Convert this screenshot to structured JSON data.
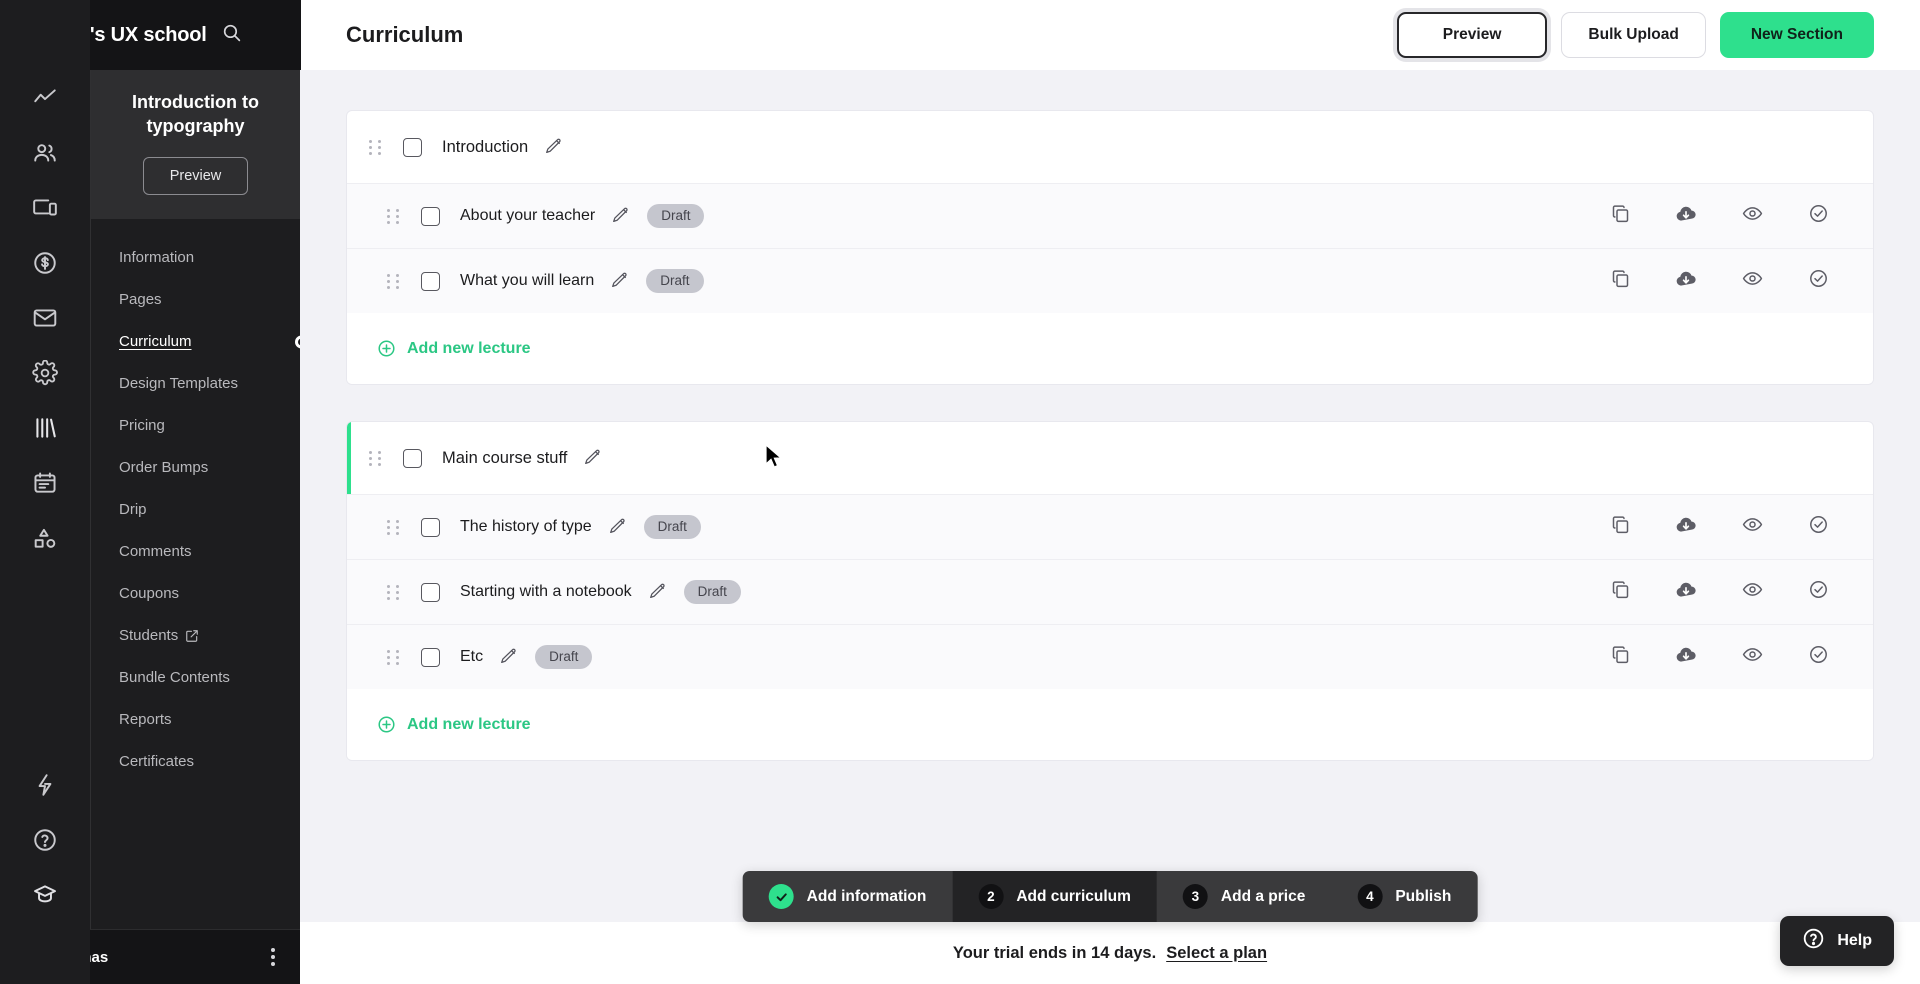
{
  "brand": {
    "title": "UI Feed's UX school",
    "search_icon": "search-icon"
  },
  "rail": {
    "icons": [
      {
        "name": "analytics-icon"
      },
      {
        "name": "audience-icon"
      },
      {
        "name": "devices-icon"
      },
      {
        "name": "dollar-circle-icon"
      },
      {
        "name": "mail-icon"
      },
      {
        "name": "settings-gear-icon"
      },
      {
        "name": "library-books-icon"
      },
      {
        "name": "calendar-icon"
      },
      {
        "name": "shapes-icon"
      }
    ],
    "bottom_icons": [
      {
        "name": "lightning-icon"
      },
      {
        "name": "help-circle-icon"
      },
      {
        "name": "graduation-cap-icon"
      }
    ]
  },
  "course": {
    "title": "Introduction to typography",
    "preview_label": "Preview"
  },
  "subnav": {
    "items": [
      {
        "label": "Information",
        "active": false,
        "external": false,
        "spinner": false
      },
      {
        "label": "Pages",
        "active": false,
        "external": false,
        "spinner": false
      },
      {
        "label": "Curriculum",
        "active": true,
        "external": false,
        "spinner": true
      },
      {
        "label": "Design Templates",
        "active": false,
        "external": false,
        "spinner": false
      },
      {
        "label": "Pricing",
        "active": false,
        "external": false,
        "spinner": false
      },
      {
        "label": "Order Bumps",
        "active": false,
        "external": false,
        "spinner": false
      },
      {
        "label": "Drip",
        "active": false,
        "external": false,
        "spinner": false
      },
      {
        "label": "Comments",
        "active": false,
        "external": false,
        "spinner": false
      },
      {
        "label": "Coupons",
        "active": false,
        "external": false,
        "spinner": false
      },
      {
        "label": "Students",
        "active": false,
        "external": true,
        "spinner": false
      },
      {
        "label": "Bundle Contents",
        "active": false,
        "external": false,
        "spinner": false
      },
      {
        "label": "Reports",
        "active": false,
        "external": false,
        "spinner": false
      },
      {
        "label": "Certificates",
        "active": false,
        "external": false,
        "spinner": false
      }
    ]
  },
  "user": {
    "name": "Sarah Jonas",
    "menu_icon": "kebab-menu-icon"
  },
  "header": {
    "page_title": "Curriculum",
    "preview_label": "Preview",
    "bulk_upload_label": "Bulk Upload",
    "new_section_label": "New Section"
  },
  "curriculum": {
    "row_action_icons": [
      "duplicate-icon",
      "cloud-download-icon",
      "eye-icon",
      "check-circle-icon"
    ],
    "add_lecture_label": "Add new lecture",
    "sections": [
      {
        "title": "Introduction",
        "accent": false,
        "lectures": [
          {
            "title": "About your teacher",
            "status": "Draft"
          },
          {
            "title": "What you will learn",
            "status": "Draft"
          }
        ]
      },
      {
        "title": "Main course stuff",
        "accent": true,
        "lectures": [
          {
            "title": "The history of type",
            "status": "Draft"
          },
          {
            "title": "Starting with a notebook",
            "status": "Draft"
          },
          {
            "title": "Etc",
            "status": "Draft"
          }
        ]
      }
    ]
  },
  "steps": [
    {
      "num": "1",
      "label": "Add information",
      "state": "done"
    },
    {
      "num": "2",
      "label": "Add curriculum",
      "state": "active"
    },
    {
      "num": "3",
      "label": "Add a price",
      "state": "todo"
    },
    {
      "num": "4",
      "label": "Publish",
      "state": "todo"
    }
  ],
  "trial": {
    "text": "Your trial ends in 14 days.",
    "link_label": "Select a plan"
  },
  "help": {
    "label": "Help",
    "icon": "question-circle-icon"
  },
  "colors": {
    "accent_green": "#2ee08d",
    "sidebar_dark": "#1d1d1f",
    "topbar_dark": "#141416",
    "page_bg": "#f2f2f6",
    "badge_bg": "#c5c6ce"
  }
}
